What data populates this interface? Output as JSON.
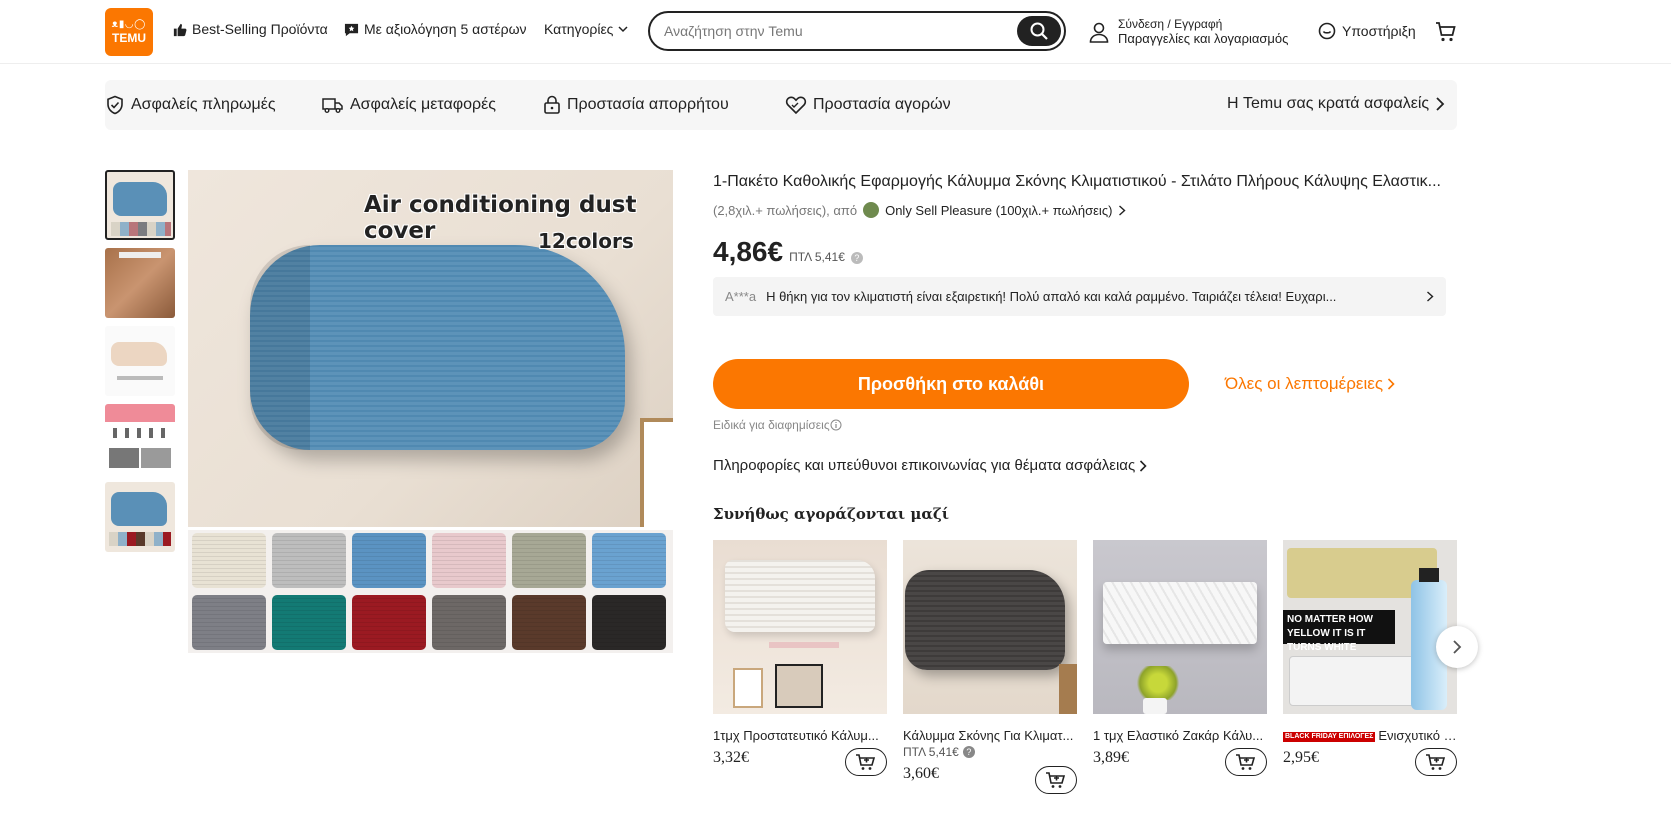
{
  "header": {
    "logo_glyphs": "ᴥ▮◡◯",
    "logo_text": "TEMU",
    "nav": {
      "best_selling": "Best-Selling Προϊόντα",
      "five_star": "Με αξιολόγηση 5 αστέρων",
      "categories": "Κατηγορίες"
    },
    "search_placeholder": "Αναζήτηση στην Temu",
    "account_line1": "Σύνδεση / Εγγραφή",
    "account_line2": "Παραγγελίες και λογαριασμός",
    "support": "Υποστήριξη"
  },
  "trust_bar": {
    "items": [
      "Ασφαλείς πληρωμές",
      "Ασφαλείς μεταφορές",
      "Προστασία απορρήτου",
      "Προστασία αγορών"
    ],
    "right": "Η Temu σας κρατά ασφαλείς"
  },
  "gallery": {
    "caption1": "Air conditioning dust cover",
    "caption2": "12colors",
    "swatch_colors": [
      "#e8e2d4",
      "#bdbdbd",
      "#5b93c2",
      "#e8c9cc",
      "#a7a895",
      "#6aa2d0",
      "#7e7f86",
      "#137a74",
      "#9b1a22",
      "#6d6866",
      "#5a3a2b",
      "#2a2827"
    ]
  },
  "product": {
    "title": "1-Πακέτο Καθολικής Εφαρμογής Κάλυμμα Σκόνης Κλιματιστικού - Στιλάτο Πλήρους Κάλυψης Ελαστικ...",
    "sales": "(2,8χιλ.+ πωλήσεις), από",
    "seller": "Only Sell Pleasure (100χιλ.+ πωλήσεις)",
    "price": "4,86€",
    "ptl": "ΠΤΛ 5,41€",
    "review_user": "A***a",
    "review_text": "Η θήκη για τον κλιματιστή είναι εξαιρετική! Πολύ απαλό και καλά ραμμένο. Ταιριάζει τέλεια! Ευχαρι...",
    "add_to_cart": "Προσθήκη στο καλάθι",
    "all_details": "Όλες οι λεπτομέρειες",
    "ad_note": "Ειδικά για διαφημίσεις",
    "safety_info": "Πληροφορίες και υπεύθυνοι επικοινωνίας για θέματα ασφάλειας"
  },
  "bought_together": {
    "heading": "Συνήθως αγοράζονται μαζί",
    "items": [
      {
        "name": "1τμχ Προστατευτικό Κάλυμ...",
        "price": "3,32€",
        "ptl": ""
      },
      {
        "name": "Κάλυμμα Σκόνης Για Κλιματ...",
        "price": "3,60€",
        "ptl": "ΠΤΛ 5,41€"
      },
      {
        "name": "1 τμχ Ελαστικό Ζακάρ Κάλυ...",
        "price": "3,89€",
        "ptl": ""
      },
      {
        "name": "Ενισχυτικό Πλαστι...",
        "price": "2,95€",
        "ptl": "",
        "badge": "BLACK FRIDAY ΕΠΙΛΟΓΕΣ"
      }
    ],
    "card4_overlay": "NO MATTER HOW YELLOW IT IS IT TURNS WHITE"
  }
}
